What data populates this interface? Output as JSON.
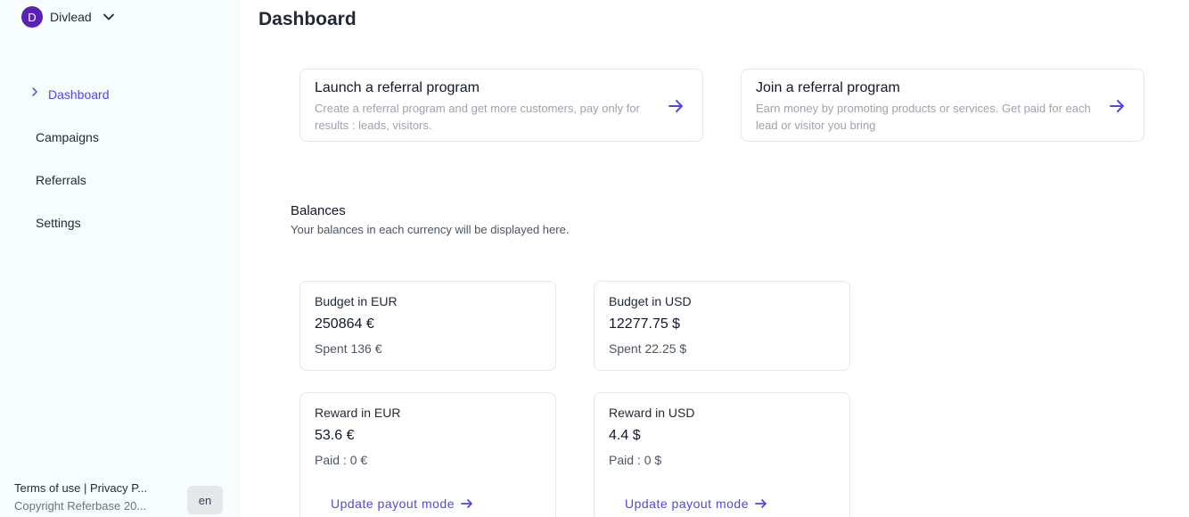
{
  "sidebar": {
    "org": {
      "initial": "D",
      "name": "Divlead"
    },
    "items": [
      {
        "label": "Dashboard",
        "active": true
      },
      {
        "label": "Campaigns"
      },
      {
        "label": "Referrals"
      },
      {
        "label": "Settings"
      }
    ],
    "footer": {
      "legal": "Terms of use | Privacy P...",
      "copyright": "Copyright Referbase 20...",
      "language": "en"
    }
  },
  "main": {
    "title": "Dashboard",
    "programs": [
      {
        "title": "Launch a referral program",
        "description": "Create a referral program and get more customers, pay only for results : leads, visitors."
      },
      {
        "title": "Join a referral program",
        "description": "Earn money by promoting products or services. Get paid for each lead or visitor you bring"
      }
    ],
    "balances": {
      "title": "Balances",
      "subtitle": "Your balances in each currency will be displayed here.",
      "budgets": [
        {
          "label": "Budget in EUR",
          "amount": "250864 €",
          "spent": "Spent 136 €"
        },
        {
          "label": "Budget in USD",
          "amount": "12277.75 $",
          "spent": "Spent 22.25 $"
        }
      ],
      "rewards": [
        {
          "label": "Reward in EUR",
          "amount": "53.6 €",
          "paid": "Paid : 0 €",
          "link": "Update payout mode"
        },
        {
          "label": "Reward in USD",
          "amount": "4.4 $",
          "paid": "Paid : 0 $",
          "link": "Update payout mode"
        }
      ]
    }
  },
  "colors": {
    "accent": "#4f46e5",
    "avatar": "#5b21b6",
    "sidebar_bg": "#f7fdfc"
  }
}
